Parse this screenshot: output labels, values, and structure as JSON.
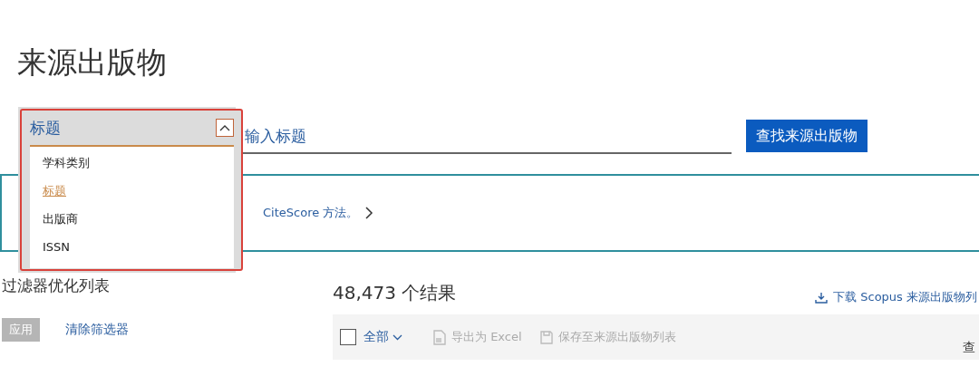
{
  "page_title": "来源出版物",
  "search": {
    "field_type": {
      "value": "标题",
      "expanded": true,
      "options": [
        {
          "label": "学科类别",
          "selected": false
        },
        {
          "label": "标题",
          "selected": true
        },
        {
          "label": "出版商",
          "selected": false
        },
        {
          "label": "ISSN",
          "selected": false
        }
      ]
    },
    "placeholder": "输入标题",
    "button": "查找来源出版物"
  },
  "info_banner": {
    "text": "CiteScore 方法。"
  },
  "filters": {
    "title": "过滤器优化列表",
    "apply_button": "应用",
    "clear_link": "清除筛选器"
  },
  "results": {
    "count": "48,473 个结果",
    "download_link": "下载 Scopus 来源出版物列",
    "toolbar": {
      "select_all": {
        "label": "全部",
        "checked": false
      },
      "export": "导出为 Excel",
      "save": "保存至来源出版物列表",
      "view": "查"
    }
  }
}
